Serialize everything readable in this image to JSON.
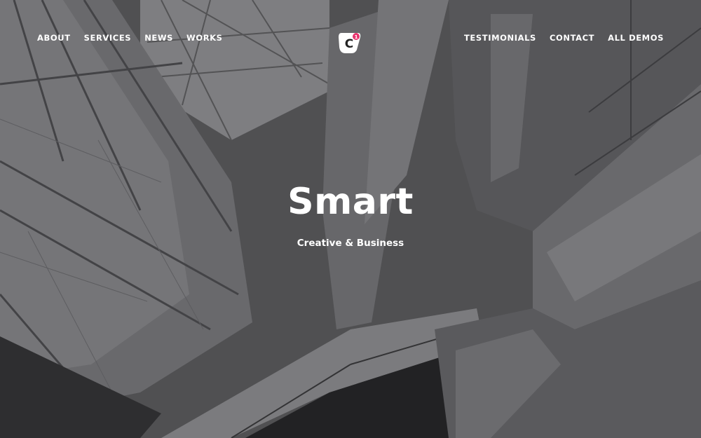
{
  "nav": {
    "left": [
      {
        "label": "ABOUT"
      },
      {
        "label": "SERVICES"
      },
      {
        "label": "NEWS"
      },
      {
        "label": "WORKS"
      }
    ],
    "right": [
      {
        "label": "TESTIMONIALS"
      },
      {
        "label": "CONTACT"
      },
      {
        "label": "ALL DEMOS"
      }
    ]
  },
  "logo": {
    "letter": "C",
    "badge": "1",
    "badge_color": "#e8336d",
    "icon": "brand-logo-icon"
  },
  "hero": {
    "title": "Smart",
    "subtitle": "Creative & Business",
    "image": "architecture-interior-grayscale"
  },
  "colors": {
    "text": "#ffffff",
    "accent": "#e8336d"
  }
}
